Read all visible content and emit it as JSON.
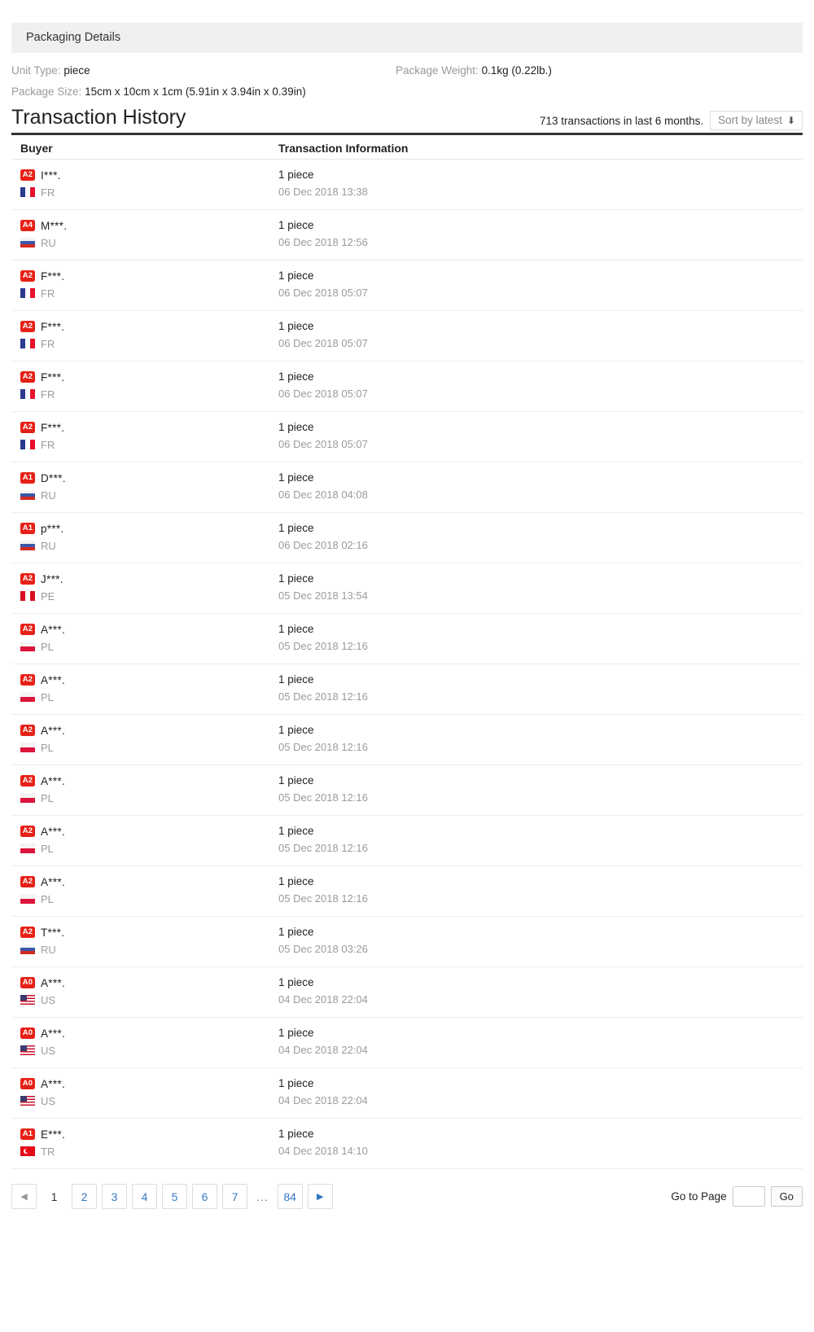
{
  "packaging": {
    "section_title": "Packaging Details",
    "unit_type_label": "Unit Type:",
    "unit_type_value": "piece",
    "package_size_label": "Package Size:",
    "package_size_value": "15cm x 10cm x 1cm (5.91in x 3.94in x 0.39in)",
    "package_weight_label": "Package Weight:",
    "package_weight_value": "0.1kg (0.22lb.)"
  },
  "transaction_history": {
    "title": "Transaction History",
    "count_text": "713 transactions in last 6 months.",
    "sort_label": "Sort by latest",
    "sort_icon": "arrow-down-icon",
    "columns": {
      "buyer": "Buyer",
      "info": "Transaction Information"
    },
    "rows": [
      {
        "level": "A2",
        "name": "I***.",
        "flag": "fr",
        "country": "FR",
        "qty": "1 piece",
        "date": "06 Dec 2018 13:38"
      },
      {
        "level": "A4",
        "name": "M***.",
        "flag": "ru",
        "country": "RU",
        "qty": "1 piece",
        "date": "06 Dec 2018 12:56"
      },
      {
        "level": "A2",
        "name": "F***.",
        "flag": "fr",
        "country": "FR",
        "qty": "1 piece",
        "date": "06 Dec 2018 05:07"
      },
      {
        "level": "A2",
        "name": "F***.",
        "flag": "fr",
        "country": "FR",
        "qty": "1 piece",
        "date": "06 Dec 2018 05:07"
      },
      {
        "level": "A2",
        "name": "F***.",
        "flag": "fr",
        "country": "FR",
        "qty": "1 piece",
        "date": "06 Dec 2018 05:07"
      },
      {
        "level": "A2",
        "name": "F***.",
        "flag": "fr",
        "country": "FR",
        "qty": "1 piece",
        "date": "06 Dec 2018 05:07"
      },
      {
        "level": "A1",
        "name": "D***.",
        "flag": "ru",
        "country": "RU",
        "qty": "1 piece",
        "date": "06 Dec 2018 04:08"
      },
      {
        "level": "A1",
        "name": "p***.",
        "flag": "ru",
        "country": "RU",
        "qty": "1 piece",
        "date": "06 Dec 2018 02:16"
      },
      {
        "level": "A2",
        "name": "J***.",
        "flag": "pe",
        "country": "PE",
        "qty": "1 piece",
        "date": "05 Dec 2018 13:54"
      },
      {
        "level": "A2",
        "name": "A***.",
        "flag": "pl",
        "country": "PL",
        "qty": "1 piece",
        "date": "05 Dec 2018 12:16"
      },
      {
        "level": "A2",
        "name": "A***.",
        "flag": "pl",
        "country": "PL",
        "qty": "1 piece",
        "date": "05 Dec 2018 12:16"
      },
      {
        "level": "A2",
        "name": "A***.",
        "flag": "pl",
        "country": "PL",
        "qty": "1 piece",
        "date": "05 Dec 2018 12:16"
      },
      {
        "level": "A2",
        "name": "A***.",
        "flag": "pl",
        "country": "PL",
        "qty": "1 piece",
        "date": "05 Dec 2018 12:16"
      },
      {
        "level": "A2",
        "name": "A***.",
        "flag": "pl",
        "country": "PL",
        "qty": "1 piece",
        "date": "05 Dec 2018 12:16"
      },
      {
        "level": "A2",
        "name": "A***.",
        "flag": "pl",
        "country": "PL",
        "qty": "1 piece",
        "date": "05 Dec 2018 12:16"
      },
      {
        "level": "A2",
        "name": "T***.",
        "flag": "ru",
        "country": "RU",
        "qty": "1 piece",
        "date": "05 Dec 2018 03:26"
      },
      {
        "level": "A0",
        "name": "A***.",
        "flag": "us",
        "country": "US",
        "qty": "1 piece",
        "date": "04 Dec 2018 22:04"
      },
      {
        "level": "A0",
        "name": "A***.",
        "flag": "us",
        "country": "US",
        "qty": "1 piece",
        "date": "04 Dec 2018 22:04"
      },
      {
        "level": "A0",
        "name": "A***.",
        "flag": "us",
        "country": "US",
        "qty": "1 piece",
        "date": "04 Dec 2018 22:04"
      },
      {
        "level": "A1",
        "name": "E***.",
        "flag": "tr",
        "country": "TR",
        "qty": "1 piece",
        "date": "04 Dec 2018 14:10"
      }
    ]
  },
  "pagination": {
    "prev_icon": "chevron-left-icon",
    "next_icon": "chevron-right-icon",
    "pages": [
      "1",
      "2",
      "3",
      "4",
      "5",
      "6",
      "7"
    ],
    "ellipsis": "...",
    "last_page": "84",
    "current_page": "1",
    "goto_label": "Go to Page",
    "goto_value": "",
    "goto_placeholder": "",
    "go_label": "Go"
  },
  "colors": {
    "badge_red": "#e62117",
    "link_blue": "#3579c1"
  }
}
